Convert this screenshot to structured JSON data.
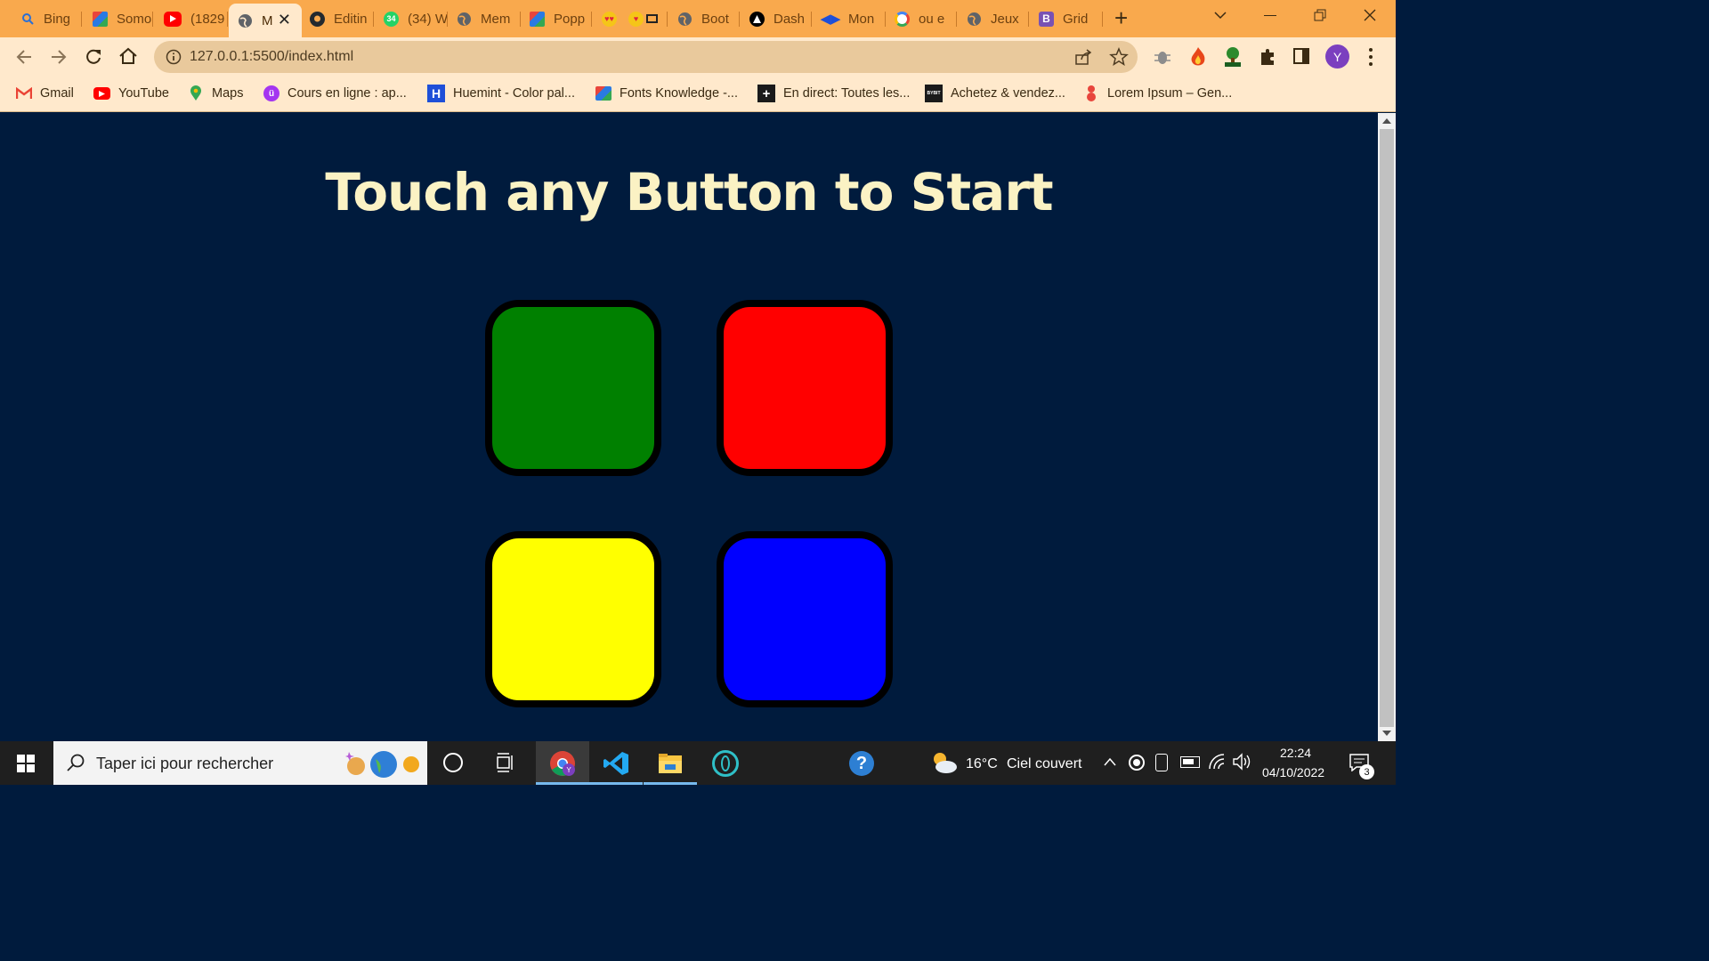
{
  "browser": {
    "tabs": [
      {
        "title": "Bing",
        "icon": "bing-icon",
        "color": "#2a7ae2"
      },
      {
        "title": "Somo",
        "icon": "colorful-logo-icon",
        "color": "#e8453c"
      },
      {
        "title": "(1829",
        "icon": "youtube-icon",
        "color": "#ff0000"
      },
      {
        "title": "M",
        "icon": "globe-icon",
        "color": "#5f6368",
        "active": true
      },
      {
        "title": "Editin",
        "icon": "github-icon",
        "color": "#24292e"
      },
      {
        "title": "(34) W",
        "icon": "whatsapp-icon",
        "color": "#25d366",
        "badge": "34"
      },
      {
        "title": "Mem",
        "icon": "globe-icon",
        "color": "#5f6368"
      },
      {
        "title": "Popp",
        "icon": "colorful-logo-icon",
        "color": "#e8453c"
      },
      {
        "title": "",
        "icon": "heart-eyes-emoji-icon",
        "color": "#f5c518"
      },
      {
        "title": "",
        "icon": "emoji-screen-icon",
        "color": "#f5c518"
      },
      {
        "title": "Boot",
        "icon": "globe-icon",
        "color": "#5f6368"
      },
      {
        "title": "Dash",
        "icon": "triangle-logo-icon",
        "color": "#000000"
      },
      {
        "title": "Mon",
        "icon": "arrows-logo-icon",
        "color": "#1e4fd8"
      },
      {
        "title": "ou e",
        "icon": "google-icon",
        "color": "#4285f4"
      },
      {
        "title": "Jeux",
        "icon": "globe-icon",
        "color": "#5f6368"
      },
      {
        "title": "Grid",
        "icon": "bootstrap-icon",
        "color": "#7952b3"
      }
    ],
    "new_tab_label": "+",
    "url": "127.0.0.1:5500/index.html",
    "profile_initial": "Y",
    "bookmarks": [
      {
        "label": "Gmail",
        "icon": "gmail-icon"
      },
      {
        "label": "YouTube",
        "icon": "youtube-icon"
      },
      {
        "label": "Maps",
        "icon": "maps-icon"
      },
      {
        "label": "Cours en ligne  : ap...",
        "icon": "udemy-icon"
      },
      {
        "label": "Huemint - Color pal...",
        "icon": "huemint-icon"
      },
      {
        "label": "Fonts Knowledge -...",
        "icon": "colorful-logo-icon"
      },
      {
        "label": "En direct: Toutes les...",
        "icon": "plus-square-icon"
      },
      {
        "label": "Achetez & vendez...",
        "icon": "bybit-icon"
      },
      {
        "label": "Lorem Ipsum – Gen...",
        "icon": "lorem-icon"
      }
    ]
  },
  "page": {
    "headline": "Touch any Button to Start",
    "background": "#001b3d",
    "headline_color": "#fbf2c4",
    "buttons": [
      {
        "name": "green",
        "color": "#008000"
      },
      {
        "name": "red",
        "color": "#ff0000"
      },
      {
        "name": "yellow",
        "color": "#ffff00"
      },
      {
        "name": "blue",
        "color": "#0000ff"
      }
    ]
  },
  "taskbar": {
    "search_placeholder": "Taper ici pour rechercher",
    "weather_temp": "16°C",
    "weather_text": "Ciel couvert",
    "time": "22:24",
    "date": "04/10/2022",
    "notification_count": "3"
  }
}
